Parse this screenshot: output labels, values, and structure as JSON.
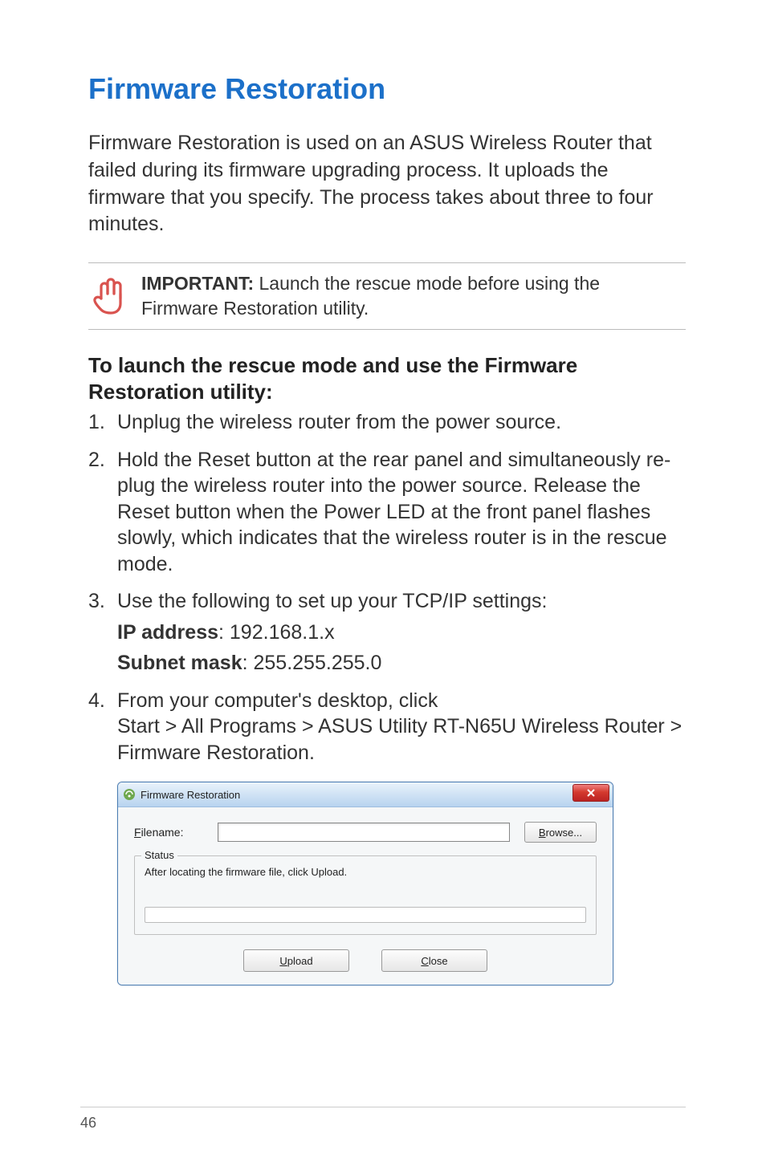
{
  "title": "Firmware Restoration",
  "intro": "Firmware Restoration is used on an ASUS Wireless Router that failed during its firmware upgrading process. It uploads the firmware that you specify. The process takes about three to four minutes.",
  "important": {
    "label": "IMPORTANT:",
    "text": " Launch the rescue mode before using the Firmware Restoration utility."
  },
  "subheading": "To launch the rescue mode and use the Firmware Restoration utility:",
  "steps": {
    "s1": "Unplug the wireless router from the power source.",
    "s2": "Hold the Reset button at the rear panel and simultaneously re-plug the wireless router into the power source. Release the Reset button when the Power LED at the front panel flashes slowly, which indicates that the wireless router is in the rescue mode.",
    "s3": {
      "intro": "Use the following to set up your TCP/IP settings:",
      "ip_label": "IP address",
      "ip_value": ": 192.168.1.x",
      "mask_label": "Subnet mask",
      "mask_value": ": 255.255.255.0"
    },
    "s4": {
      "pre": "From your computer's desktop, click",
      "b1": "Start",
      "gt1": " > ",
      "b2": "All Programs",
      "gt2": " > ",
      "b3": "ASUS Utility RT-N65U Wireless Router",
      "gt3": " > ",
      "b4": "Firmware Restoration",
      "period": "."
    }
  },
  "window": {
    "title": "Firmware Restoration",
    "file_label_prefix": "F",
    "file_label_rest": "ilename:",
    "browse_prefix": "B",
    "browse_rest": "rowse...",
    "status_legend": "Status",
    "status_msg": "After locating the firmware file, click Upload.",
    "upload_prefix": "U",
    "upload_rest": "pload",
    "close_prefix": "C",
    "close_rest": "lose"
  },
  "page_number": "46"
}
